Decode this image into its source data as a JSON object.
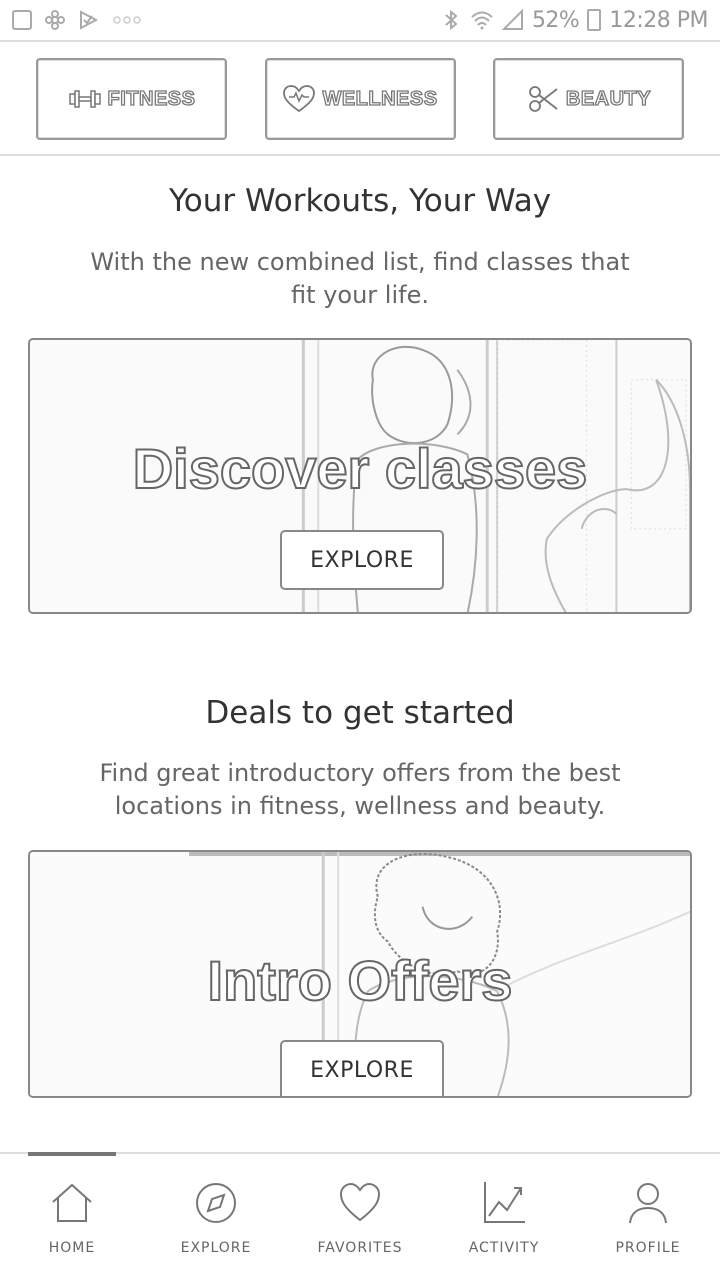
{
  "status_bar": {
    "battery": "52%",
    "time": "12:28 PM",
    "left_icons": [
      "gallery-icon",
      "pinwheel-icon",
      "check-flag-icon",
      "more-dots-icon"
    ],
    "right_icons": [
      "bluetooth-icon",
      "wifi-icon",
      "signal-icon",
      "battery-icon"
    ]
  },
  "categories": [
    {
      "label": "FITNESS",
      "icon": "dumbbell-icon"
    },
    {
      "label": "WELLNESS",
      "icon": "heart-pulse-icon"
    },
    {
      "label": "BEAUTY",
      "icon": "scissors-icon"
    }
  ],
  "sections": [
    {
      "title": "Your Workouts, Your Way",
      "subtitle": "With the new combined list, find classes that fit your life.",
      "banner_title": "Discover classes",
      "button_label": "EXPLORE"
    },
    {
      "title": "Deals to get started",
      "subtitle": "Find great introductory offers from the best locations in fitness, wellness and beauty.",
      "banner_title": "Intro Offers",
      "button_label": "EXPLORE"
    }
  ],
  "bottom_nav": [
    {
      "label": "HOME",
      "icon": "home-icon",
      "active": true
    },
    {
      "label": "EXPLORE",
      "icon": "compass-icon",
      "active": false
    },
    {
      "label": "FAVORITES",
      "icon": "heart-icon",
      "active": false
    },
    {
      "label": "ACTIVITY",
      "icon": "chart-icon",
      "active": false
    },
    {
      "label": "PROFILE",
      "icon": "person-icon",
      "active": false
    }
  ]
}
